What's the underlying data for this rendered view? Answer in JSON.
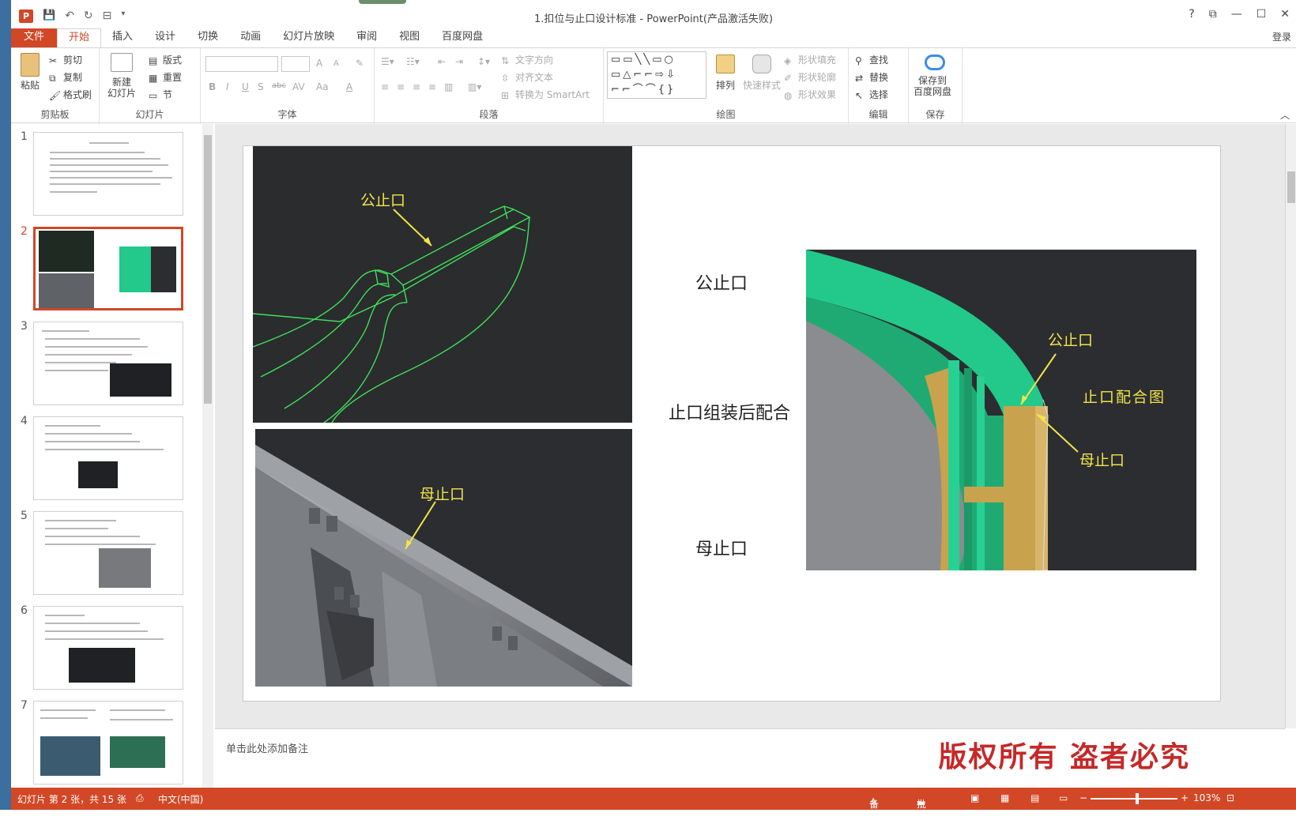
{
  "window": {
    "title": "1.扣位与止口设计标准 - PowerPoint(产品激活失败)",
    "app_icon": "P",
    "controls": [
      "?",
      "⧉",
      "—",
      "☐",
      "✕"
    ],
    "login": "登录"
  },
  "qat": {
    "save": "💾",
    "undo": "↶",
    "redo": "↻",
    "present": "⊟",
    "more": "▾"
  },
  "tabs": [
    {
      "label": "文件"
    },
    {
      "label": "开始"
    },
    {
      "label": "插入"
    },
    {
      "label": "设计"
    },
    {
      "label": "切换"
    },
    {
      "label": "动画"
    },
    {
      "label": "幻灯片放映"
    },
    {
      "label": "审阅"
    },
    {
      "label": "视图"
    },
    {
      "label": "百度网盘"
    }
  ],
  "ribbon": {
    "clipboard": {
      "label": "剪贴板",
      "paste": "粘贴",
      "cut": "剪切",
      "copy": "复制",
      "format_painter": "格式刷"
    },
    "slides": {
      "label": "幻灯片",
      "new_slide": "新建\n幻灯片",
      "layout": "版式",
      "reset": "重置",
      "section": "节"
    },
    "font": {
      "label": "字体",
      "bold": "B",
      "italic": "I",
      "underline": "U",
      "shadow": "S",
      "strike": "abc",
      "spacing": "AV",
      "case": "Aa",
      "color": "A",
      "grow": "A",
      "shrink": "A"
    },
    "paragraph": {
      "label": "段落",
      "text_direction": "文字方向",
      "align_text": "对齐文本",
      "smartart": "转换为 SmartArt"
    },
    "drawing": {
      "label": "绘图",
      "arrange": "排列",
      "quick_styles": "快速样式",
      "fill": "形状填充",
      "outline": "形状轮廓",
      "effects": "形状效果"
    },
    "editing": {
      "label": "编辑",
      "find": "查找",
      "replace": "替换",
      "select": "选择"
    },
    "save": {
      "label": "保存",
      "save_to_cloud": "保存到\n百度网盘"
    }
  },
  "thumbnails": [
    {
      "num": "1"
    },
    {
      "num": "2"
    },
    {
      "num": "3"
    },
    {
      "num": "4"
    },
    {
      "num": "5"
    },
    {
      "num": "6"
    },
    {
      "num": "7"
    }
  ],
  "slide": {
    "label_male": "公止口",
    "label_assembly": "止口组装后配合",
    "label_female": "母止口",
    "img1_anno": "公止口",
    "img2_anno": "母止口",
    "img3_anno_male": "公止口",
    "img3_anno_female": "母止口",
    "img3_title": "止口配合图"
  },
  "notes": {
    "placeholder": "单击此处添加备注"
  },
  "watermark": "版权所有 盗者必究",
  "status": {
    "slide_info": "幻灯片 第 2 张，共 15 张",
    "language": "中文(中国)",
    "notes": "备注",
    "comments": "批注",
    "zoom": "103%",
    "zoom_level": 0.54
  },
  "colors": {
    "accent": "#d24726",
    "anno": "#f3e34a",
    "cad_green": "#3fe05a",
    "mint": "#22c98a",
    "tan": "#c9a24e"
  }
}
